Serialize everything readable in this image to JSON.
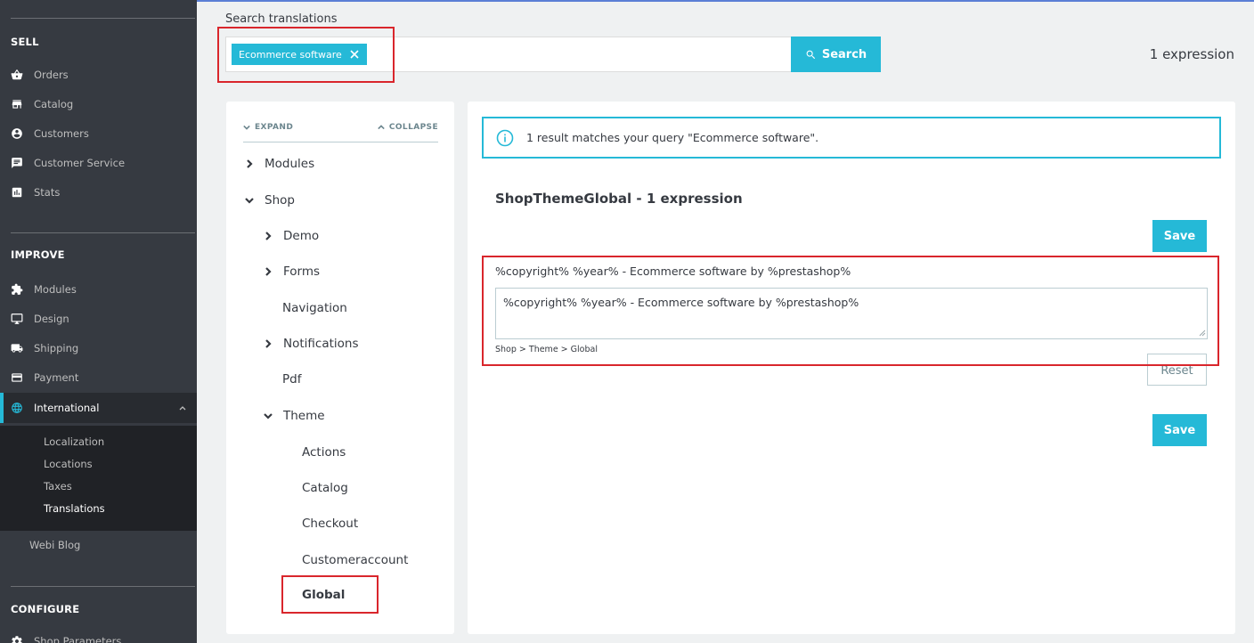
{
  "sidebar": {
    "sections": {
      "sell": "SELL",
      "improve": "IMPROVE",
      "configure": "CONFIGURE"
    },
    "sell_items": [
      {
        "label": "Orders",
        "icon": "shopping-basket-icon"
      },
      {
        "label": "Catalog",
        "icon": "store-icon"
      },
      {
        "label": "Customers",
        "icon": "account-circle-icon"
      },
      {
        "label": "Customer Service",
        "icon": "chat-icon"
      },
      {
        "label": "Stats",
        "icon": "assessment-icon"
      }
    ],
    "improve_items": [
      {
        "label": "Modules",
        "icon": "extension-icon"
      },
      {
        "label": "Design",
        "icon": "desktop-icon"
      },
      {
        "label": "Shipping",
        "icon": "truck-icon"
      },
      {
        "label": "Payment",
        "icon": "credit-card-icon"
      },
      {
        "label": "International",
        "icon": "language-icon"
      }
    ],
    "international_sub": [
      "Localization",
      "Locations",
      "Taxes",
      "Translations"
    ],
    "webi_blog": "Webi Blog",
    "configure_items": [
      {
        "label": "Shop Parameters",
        "icon": "settings-icon"
      }
    ],
    "accent_color": "#25b9d7"
  },
  "search": {
    "label": "Search translations",
    "chip": "Ecommerce software",
    "button": "Search",
    "count": "1 expression"
  },
  "tree": {
    "expand": "EXPAND",
    "collapse": "COLLAPSE",
    "nodes": {
      "modules": "Modules",
      "shop": "Shop",
      "demo": "Demo",
      "forms": "Forms",
      "navigation": "Navigation",
      "notifications": "Notifications",
      "pdf": "Pdf",
      "theme": "Theme",
      "actions": "Actions",
      "catalog": "Catalog",
      "checkout": "Checkout",
      "customeraccount": "Customeraccount",
      "global": "Global"
    }
  },
  "content": {
    "alert": "1 result matches your query \"Ecommerce software\".",
    "domain_title": "ShopThemeGlobal - 1 expression",
    "save": "Save",
    "reset": "Reset",
    "source": "%copyright% %year% - Ecommerce software by %prestashop%",
    "translation": "%copyright% %year% - Ecommerce software by %prestashop%",
    "path": "Shop > Theme > Global"
  }
}
